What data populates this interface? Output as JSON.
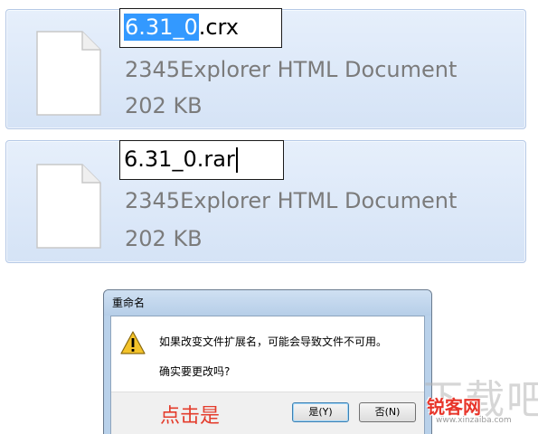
{
  "files": [
    {
      "name_selected": "6.31_0",
      "name_unselected": ".crx",
      "type": "2345Explorer HTML Document",
      "size": "202 KB"
    },
    {
      "name": "6.31_0.rar",
      "type": "2345Explorer HTML Document",
      "size": "202 KB"
    }
  ],
  "dialog": {
    "title": "重命名",
    "icon": "warning-icon",
    "message": "如果改变文件扩展名，可能会导致文件不可用。",
    "question": "确实要更改吗?",
    "hint": "点击是",
    "yes_label": "是(Y)",
    "no_label": "否(N)"
  },
  "watermark": {
    "big_text": "下载吧",
    "brand": "锐客网",
    "url": "www.xinzaiba.com"
  },
  "colors": {
    "selection": "#3399ff",
    "hint_red": "#e43c2c",
    "tile_border": "#b6c9e6"
  }
}
